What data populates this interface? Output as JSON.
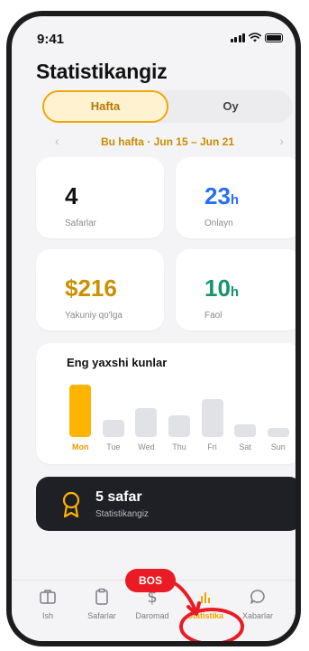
{
  "status_bar": {
    "time": "9:41"
  },
  "header": {
    "title": "Statistikangiz"
  },
  "period_tabs": [
    {
      "label": "Hafta",
      "selected": true
    },
    {
      "label": "Oy",
      "selected": false
    }
  ],
  "week_nav": {
    "prev": "‹",
    "label": "Bu hafta · Jun 15 – Jun 21",
    "next": "›"
  },
  "stats": [
    {
      "value": "4",
      "unit": "",
      "label": "Safarlar",
      "color": "#111111"
    },
    {
      "value": "23",
      "unit": "h",
      "label": "Onlayn",
      "color": "#2a6ff3"
    },
    {
      "value": "$216",
      "unit": "",
      "label": "Yakuniy qo'lga",
      "color": "#c99000"
    },
    {
      "value": "10",
      "unit": "h",
      "label": "Faol",
      "color": "#14956a"
    }
  ],
  "best_days": {
    "title": "Eng yaxshi kunlar",
    "chart_data": {
      "type": "bar",
      "categories": [
        "Mon",
        "Tue",
        "Wed",
        "Thu",
        "Fri",
        "Sat",
        "Sun"
      ],
      "values": [
        1.0,
        0.33,
        0.55,
        0.42,
        0.73,
        0.25,
        0.18
      ],
      "highlight": "Mon",
      "highlight_color": "#ffb400",
      "bar_color": "#e1e2e6"
    }
  },
  "achievement": {
    "title": "5 safar",
    "subtitle": "Statistikangiz"
  },
  "overlay": {
    "bos_label": "BOS"
  },
  "tab_bar": [
    {
      "label": "Ish",
      "icon": "briefcase-icon",
      "active": false
    },
    {
      "label": "Safarlar",
      "icon": "clipboard-icon",
      "active": false
    },
    {
      "label": "Daromad",
      "icon": "dollar-icon",
      "active": false
    },
    {
      "label": "Statistika",
      "icon": "bar-chart-icon",
      "active": true
    },
    {
      "label": "Xabarlar",
      "icon": "chat-bubble-icon",
      "active": false
    }
  ],
  "colors": {
    "accent": "#ffb400",
    "annotation_red": "#ea1b24",
    "dark_card": "#1f2026"
  }
}
